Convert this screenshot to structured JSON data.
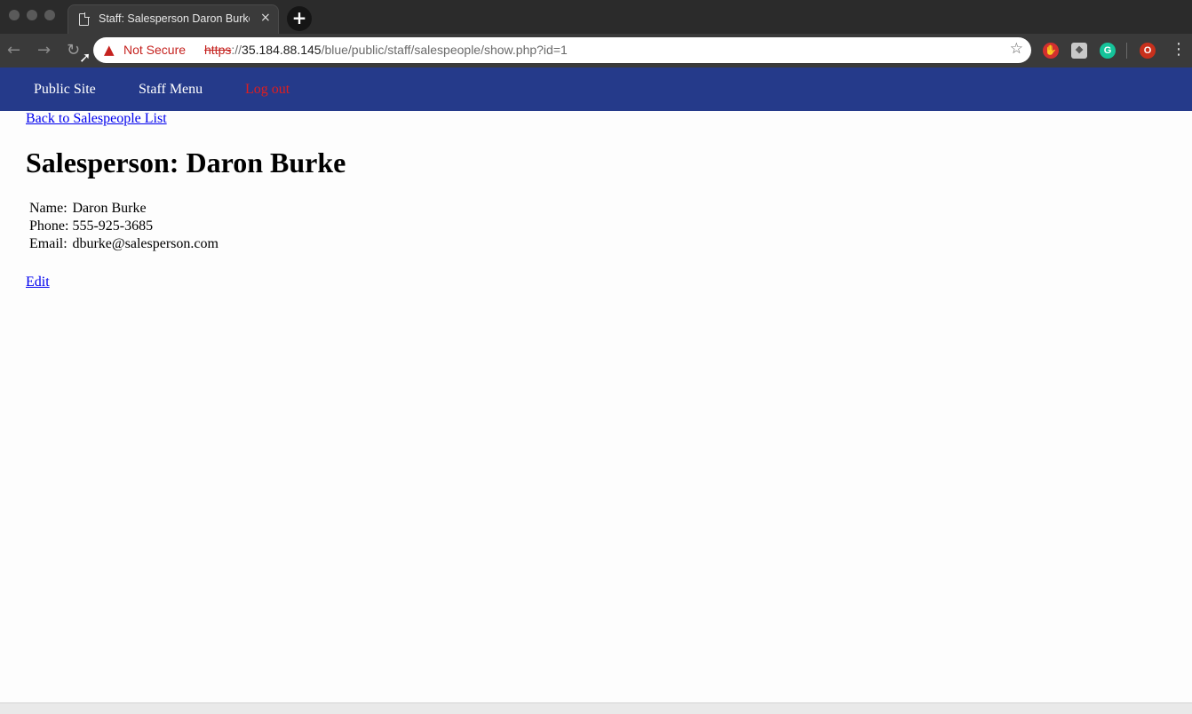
{
  "browser": {
    "tab_title": "Staff: Salesperson Daron Burke",
    "tab_close": "×",
    "new_tab": "+",
    "security_label": "Not Secure",
    "url_scheme": "https",
    "url_sep": "://",
    "url_host": "35.184.88.145",
    "url_path": "/blue/public/staff/salespeople/show.php?id=1",
    "nav_back": "←",
    "nav_forward": "→",
    "nav_reload": "↻",
    "bookmark_star": "☆",
    "menu": "⋮",
    "ext_o_label": "O",
    "colors": {
      "tabbar": "#2b2b2b",
      "toolbar": "#3a3a3a",
      "warning": "#c5221f"
    }
  },
  "site_nav": {
    "public_site": "Public Site",
    "staff_menu": "Staff Menu",
    "log_out": "Log out",
    "colors": {
      "background": "#253a8a",
      "logout": "#e01e1e"
    }
  },
  "page": {
    "back_link": "Back to Salespeople List",
    "title": "Salesperson: Daron Burke",
    "details": {
      "name_label": "Name:",
      "name_value": "Daron Burke",
      "phone_label": "Phone:",
      "phone_value": "555-925-3685",
      "email_label": "Email:",
      "email_value": "dburke@salesperson.com"
    },
    "edit_link": "Edit"
  }
}
